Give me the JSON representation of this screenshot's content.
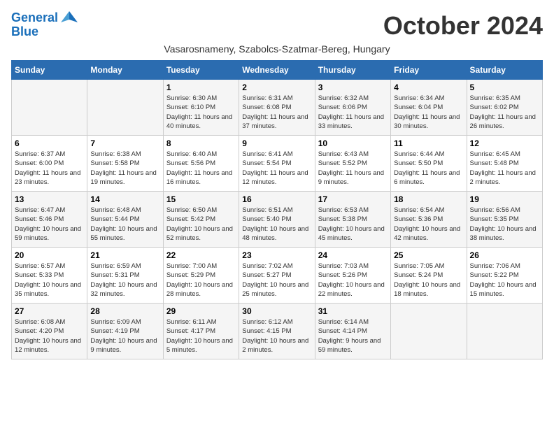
{
  "header": {
    "logo_line1": "General",
    "logo_line2": "Blue",
    "month_title": "October 2024",
    "subtitle": "Vasarosnameny, Szabolcs-Szatmar-Bereg, Hungary"
  },
  "weekdays": [
    "Sunday",
    "Monday",
    "Tuesday",
    "Wednesday",
    "Thursday",
    "Friday",
    "Saturday"
  ],
  "weeks": [
    [
      {
        "day": "",
        "info": ""
      },
      {
        "day": "",
        "info": ""
      },
      {
        "day": "1",
        "info": "Sunrise: 6:30 AM\nSunset: 6:10 PM\nDaylight: 11 hours and 40 minutes."
      },
      {
        "day": "2",
        "info": "Sunrise: 6:31 AM\nSunset: 6:08 PM\nDaylight: 11 hours and 37 minutes."
      },
      {
        "day": "3",
        "info": "Sunrise: 6:32 AM\nSunset: 6:06 PM\nDaylight: 11 hours and 33 minutes."
      },
      {
        "day": "4",
        "info": "Sunrise: 6:34 AM\nSunset: 6:04 PM\nDaylight: 11 hours and 30 minutes."
      },
      {
        "day": "5",
        "info": "Sunrise: 6:35 AM\nSunset: 6:02 PM\nDaylight: 11 hours and 26 minutes."
      }
    ],
    [
      {
        "day": "6",
        "info": "Sunrise: 6:37 AM\nSunset: 6:00 PM\nDaylight: 11 hours and 23 minutes."
      },
      {
        "day": "7",
        "info": "Sunrise: 6:38 AM\nSunset: 5:58 PM\nDaylight: 11 hours and 19 minutes."
      },
      {
        "day": "8",
        "info": "Sunrise: 6:40 AM\nSunset: 5:56 PM\nDaylight: 11 hours and 16 minutes."
      },
      {
        "day": "9",
        "info": "Sunrise: 6:41 AM\nSunset: 5:54 PM\nDaylight: 11 hours and 12 minutes."
      },
      {
        "day": "10",
        "info": "Sunrise: 6:43 AM\nSunset: 5:52 PM\nDaylight: 11 hours and 9 minutes."
      },
      {
        "day": "11",
        "info": "Sunrise: 6:44 AM\nSunset: 5:50 PM\nDaylight: 11 hours and 6 minutes."
      },
      {
        "day": "12",
        "info": "Sunrise: 6:45 AM\nSunset: 5:48 PM\nDaylight: 11 hours and 2 minutes."
      }
    ],
    [
      {
        "day": "13",
        "info": "Sunrise: 6:47 AM\nSunset: 5:46 PM\nDaylight: 10 hours and 59 minutes."
      },
      {
        "day": "14",
        "info": "Sunrise: 6:48 AM\nSunset: 5:44 PM\nDaylight: 10 hours and 55 minutes."
      },
      {
        "day": "15",
        "info": "Sunrise: 6:50 AM\nSunset: 5:42 PM\nDaylight: 10 hours and 52 minutes."
      },
      {
        "day": "16",
        "info": "Sunrise: 6:51 AM\nSunset: 5:40 PM\nDaylight: 10 hours and 48 minutes."
      },
      {
        "day": "17",
        "info": "Sunrise: 6:53 AM\nSunset: 5:38 PM\nDaylight: 10 hours and 45 minutes."
      },
      {
        "day": "18",
        "info": "Sunrise: 6:54 AM\nSunset: 5:36 PM\nDaylight: 10 hours and 42 minutes."
      },
      {
        "day": "19",
        "info": "Sunrise: 6:56 AM\nSunset: 5:35 PM\nDaylight: 10 hours and 38 minutes."
      }
    ],
    [
      {
        "day": "20",
        "info": "Sunrise: 6:57 AM\nSunset: 5:33 PM\nDaylight: 10 hours and 35 minutes."
      },
      {
        "day": "21",
        "info": "Sunrise: 6:59 AM\nSunset: 5:31 PM\nDaylight: 10 hours and 32 minutes."
      },
      {
        "day": "22",
        "info": "Sunrise: 7:00 AM\nSunset: 5:29 PM\nDaylight: 10 hours and 28 minutes."
      },
      {
        "day": "23",
        "info": "Sunrise: 7:02 AM\nSunset: 5:27 PM\nDaylight: 10 hours and 25 minutes."
      },
      {
        "day": "24",
        "info": "Sunrise: 7:03 AM\nSunset: 5:26 PM\nDaylight: 10 hours and 22 minutes."
      },
      {
        "day": "25",
        "info": "Sunrise: 7:05 AM\nSunset: 5:24 PM\nDaylight: 10 hours and 18 minutes."
      },
      {
        "day": "26",
        "info": "Sunrise: 7:06 AM\nSunset: 5:22 PM\nDaylight: 10 hours and 15 minutes."
      }
    ],
    [
      {
        "day": "27",
        "info": "Sunrise: 6:08 AM\nSunset: 4:20 PM\nDaylight: 10 hours and 12 minutes."
      },
      {
        "day": "28",
        "info": "Sunrise: 6:09 AM\nSunset: 4:19 PM\nDaylight: 10 hours and 9 minutes."
      },
      {
        "day": "29",
        "info": "Sunrise: 6:11 AM\nSunset: 4:17 PM\nDaylight: 10 hours and 5 minutes."
      },
      {
        "day": "30",
        "info": "Sunrise: 6:12 AM\nSunset: 4:15 PM\nDaylight: 10 hours and 2 minutes."
      },
      {
        "day": "31",
        "info": "Sunrise: 6:14 AM\nSunset: 4:14 PM\nDaylight: 9 hours and 59 minutes."
      },
      {
        "day": "",
        "info": ""
      },
      {
        "day": "",
        "info": ""
      }
    ]
  ]
}
